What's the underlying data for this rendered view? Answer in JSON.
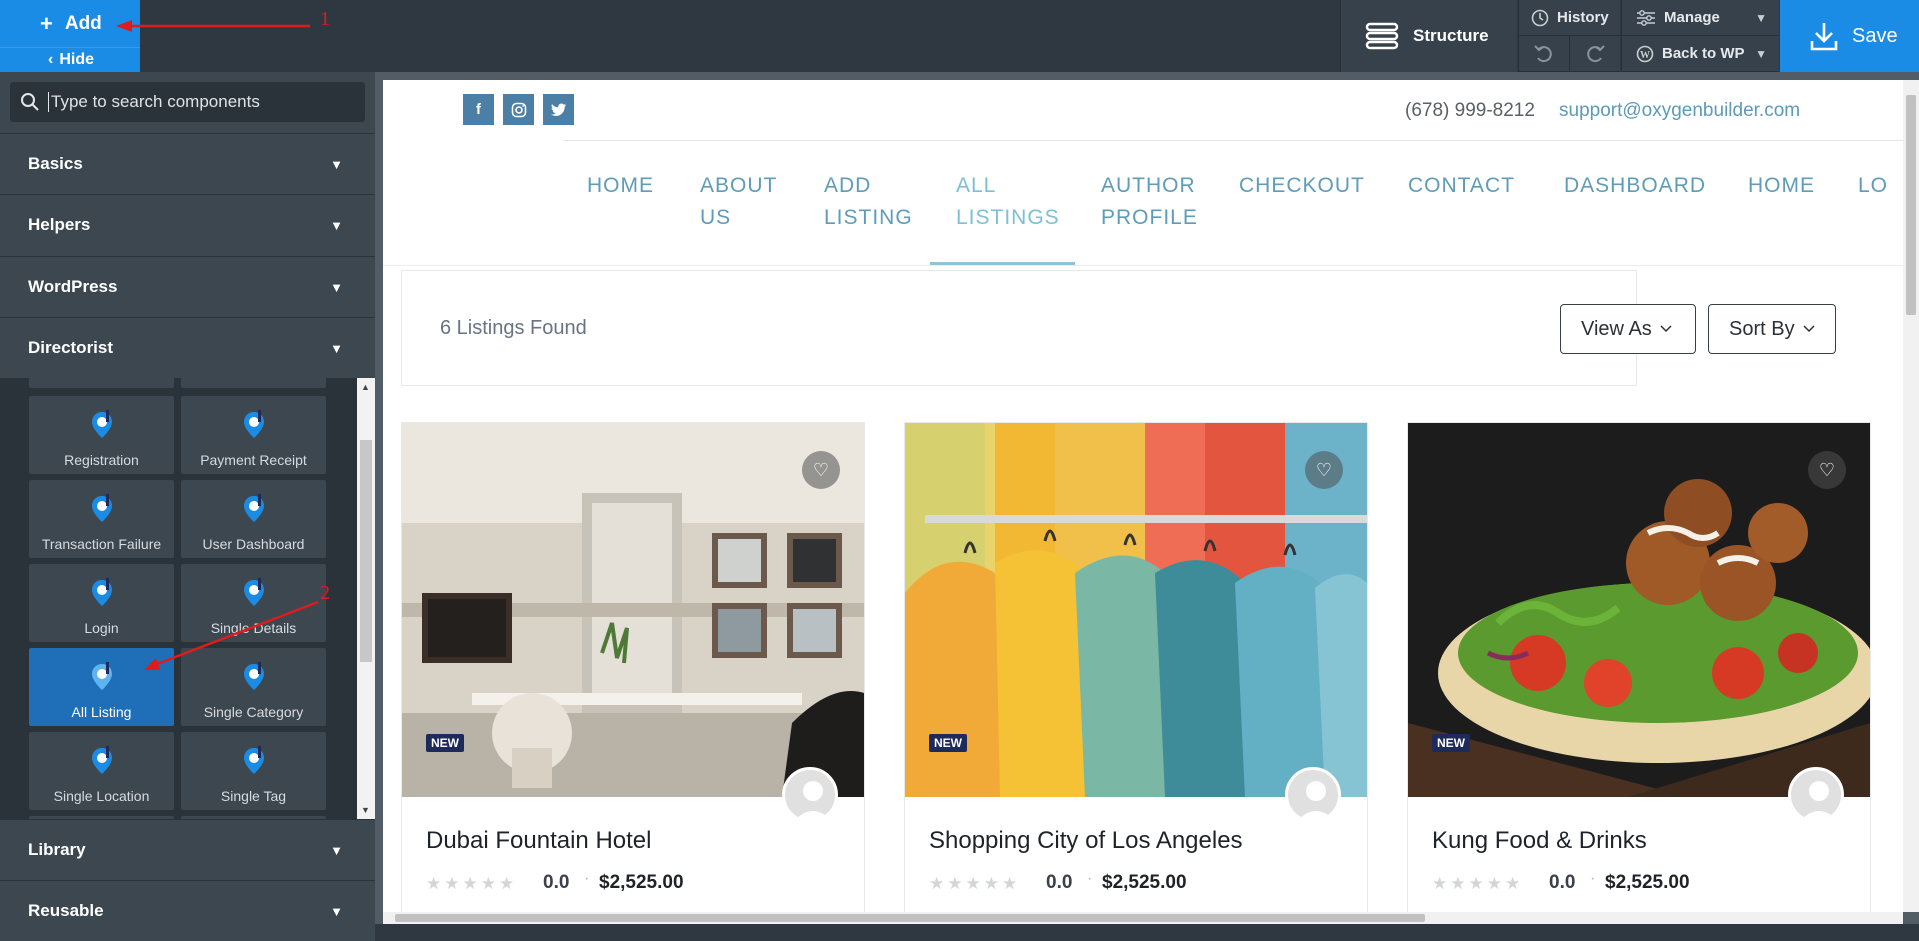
{
  "topbar": {
    "add_label": "Add",
    "hide_label": "Hide",
    "structure_label": "Structure",
    "history_label": "History",
    "manage_label": "Manage",
    "back_label": "Back to WP",
    "save_label": "Save"
  },
  "sidebar": {
    "search_placeholder": "Type to search components",
    "categories": {
      "basics": "Basics",
      "helpers": "Helpers",
      "wordpress": "WordPress",
      "directorist": "Directorist",
      "library": "Library",
      "reusable": "Reusable"
    },
    "components": [
      {
        "label": "Registration"
      },
      {
        "label": "Payment Receipt"
      },
      {
        "label": "Transaction Failure"
      },
      {
        "label": "User Dashboard"
      },
      {
        "label": "Login"
      },
      {
        "label": "Single Details"
      },
      {
        "label": "All Listing"
      },
      {
        "label": "Single Category"
      },
      {
        "label": "Single Location"
      },
      {
        "label": "Single Tag"
      }
    ]
  },
  "page": {
    "phone": "(678) 999-8212",
    "email": "support@oxygenbuilder.com",
    "nav": [
      {
        "line1": "HOME",
        "line2": ""
      },
      {
        "line1": "ABOUT",
        "line2": "US"
      },
      {
        "line1": "ADD",
        "line2": "LISTING"
      },
      {
        "line1": "ALL",
        "line2": "LISTINGS"
      },
      {
        "line1": "AUTHOR",
        "line2": "PROFILE"
      },
      {
        "line1": "CHECKOUT",
        "line2": ""
      },
      {
        "line1": "CONTACT",
        "line2": ""
      },
      {
        "line1": "DASHBOARD",
        "line2": ""
      },
      {
        "line1": "HOME",
        "line2": ""
      },
      {
        "line1": "LO",
        "line2": ""
      }
    ],
    "found_text": "6 Listings Found",
    "view_as": "View As",
    "sort_by": "Sort By",
    "listings": [
      {
        "title": "Dubai Fountain Hotel",
        "badge": "NEW",
        "rating": "0.0",
        "price": "$2,525.00"
      },
      {
        "title": "Shopping City of Los Angeles",
        "badge": "NEW",
        "rating": "0.0",
        "price": "$2,525.00"
      },
      {
        "title": "Kung Food & Drinks",
        "badge": "NEW",
        "rating": "0.0",
        "price": "$2,525.00"
      }
    ]
  },
  "annotations": {
    "one": "1",
    "two": "2"
  },
  "colors": {
    "accent": "#1a8ce5",
    "nav": "#5e9cb8",
    "active_component": "#1f6fb8"
  }
}
